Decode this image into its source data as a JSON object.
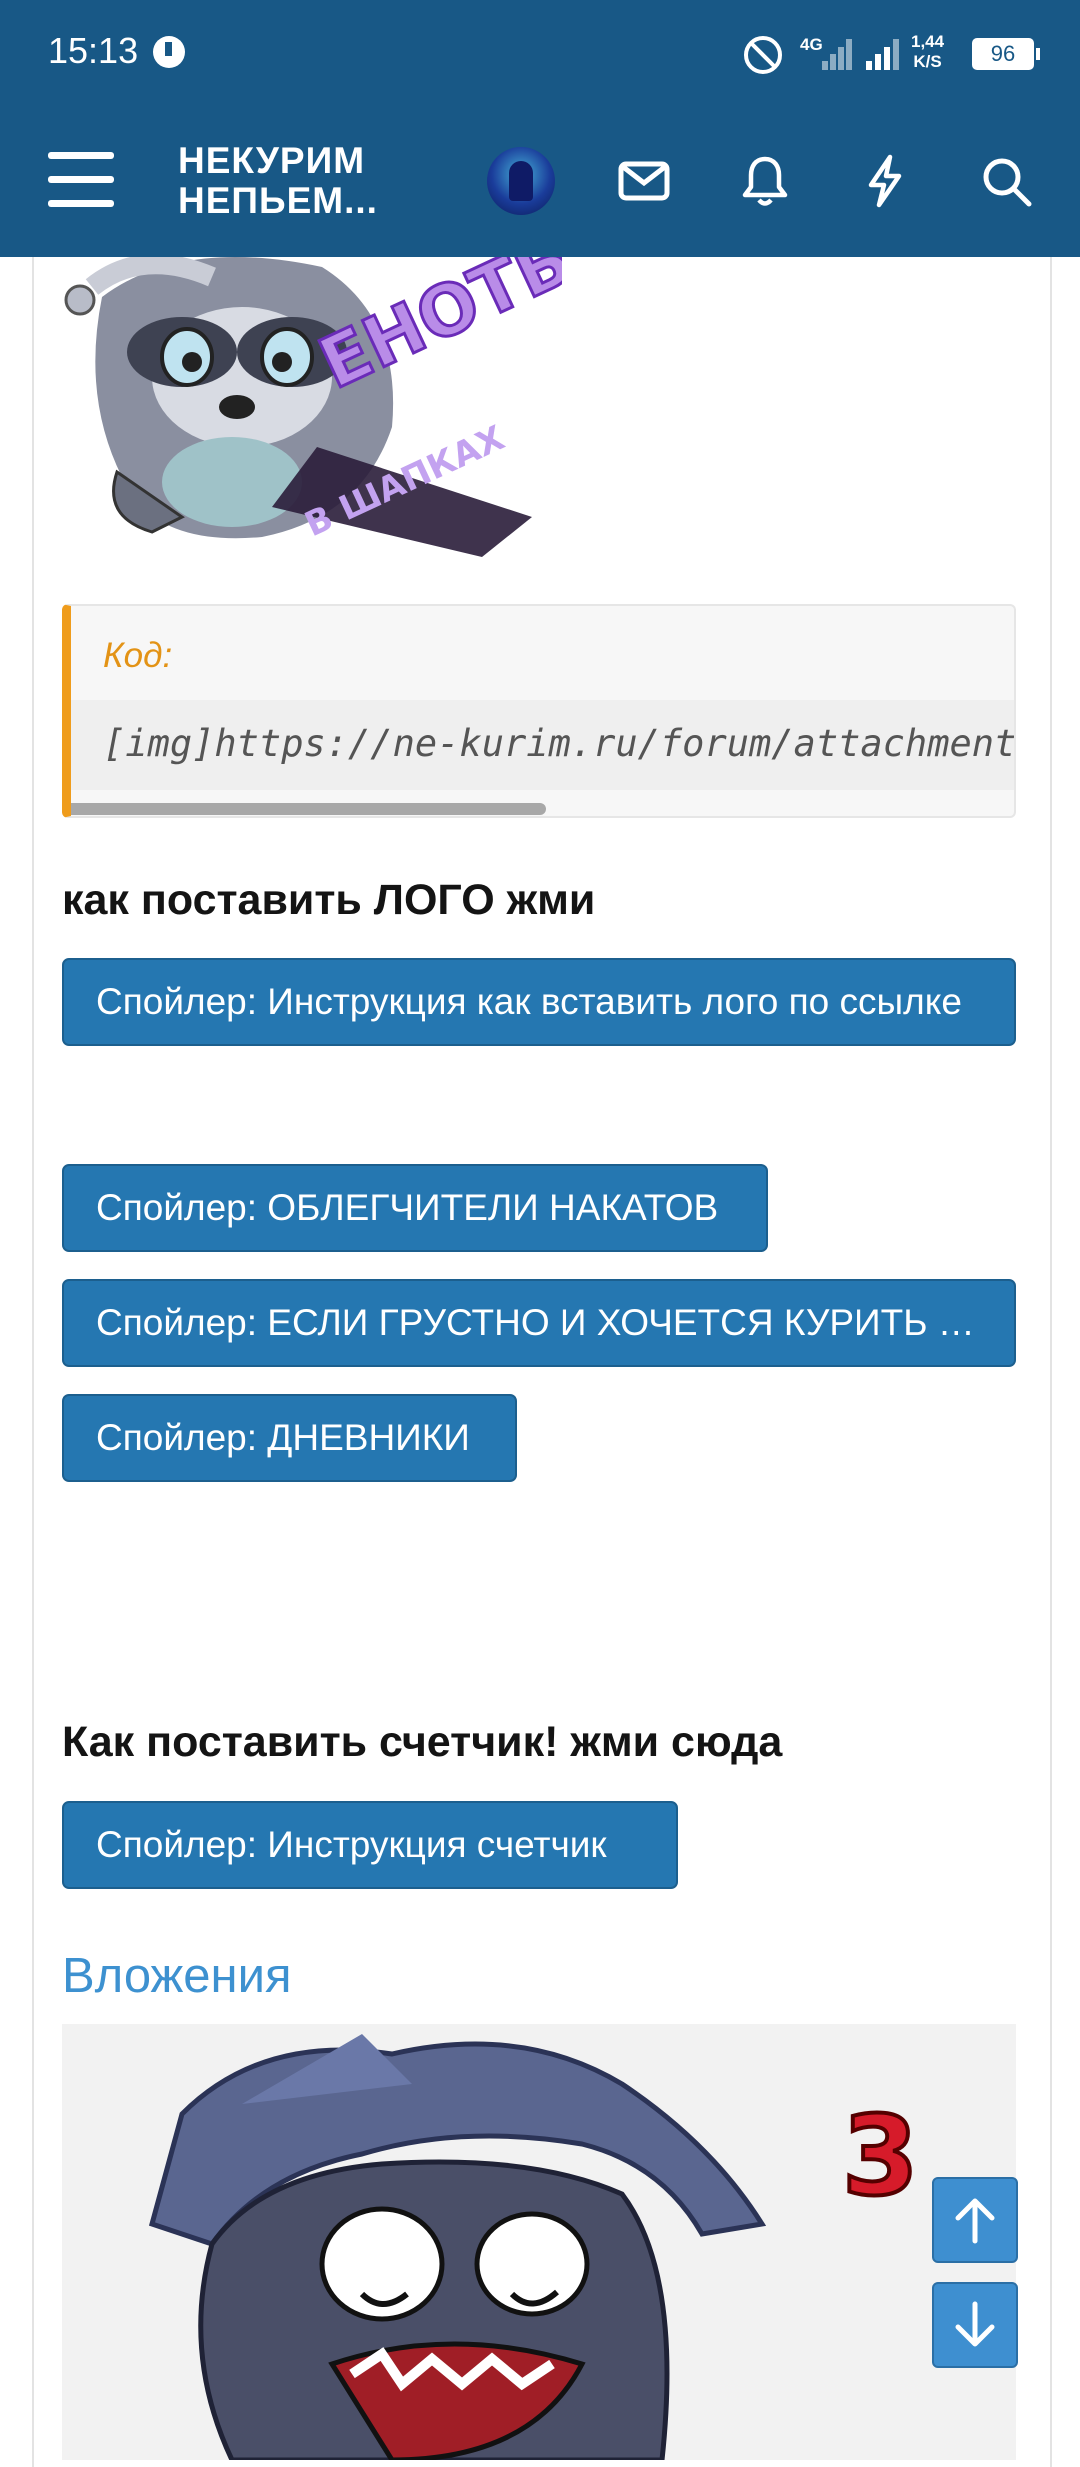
{
  "status_bar": {
    "time": "15:13",
    "network": "4G",
    "speed_value": "1,44",
    "speed_unit": "K/S",
    "battery": "96"
  },
  "header": {
    "title_line1": "НЕКУРИМ",
    "title_line2": "НЕПЬЕМ..."
  },
  "code_block": {
    "title": "Код:",
    "code": "[img]https://ne-kurim.ru/forum/attachments/"
  },
  "sections": {
    "logo_heading": "как поставить ЛОГО жми",
    "counter_heading": "Как поставить счетчик! жми сюда",
    "attachments_title": "Вложения"
  },
  "spoilers": [
    "Спойлер: Инструкция как вставить лого по ссылке",
    "Спойлер: ОБЛЕГЧИТЕЛИ НАКАТОВ",
    "Спойлер: ЕСЛИ ГРУСТНО И ХОЧЕТСЯ КУРИТЬ ЖМИ СЮДА",
    "Спойлер: ДНЕВНИКИ",
    "Спойлер: Инструкция счетчик"
  ],
  "sticker_text": {
    "top_text": "ЕНОТЫ",
    "bottom_text": "В ШАПКАХ"
  },
  "attachment_text": "3"
}
